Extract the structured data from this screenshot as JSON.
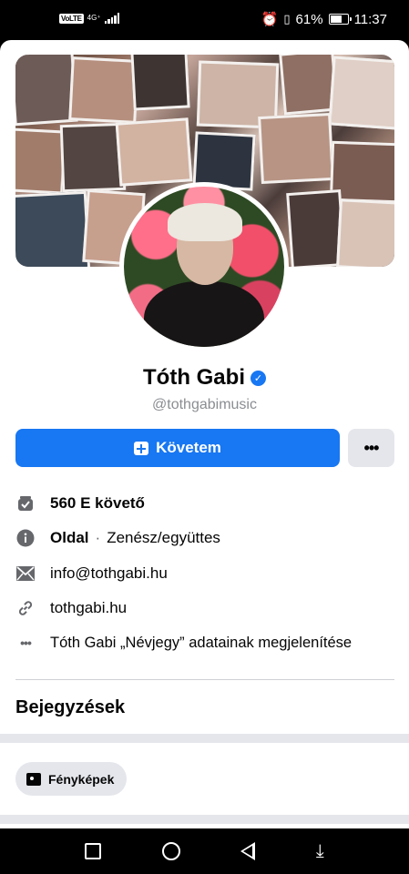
{
  "status_bar": {
    "volte": "VoLTE",
    "network": "4G⁺",
    "battery_percent": "61%",
    "time": "11:37",
    "icons": [
      "alarm-icon",
      "vibrate-icon",
      "battery-icon",
      "signal-icon"
    ]
  },
  "profile": {
    "name": "Tóth Gabi",
    "username": "@tothgabimusic",
    "verified_icon": "verified-badge-icon",
    "cover_icon": "cover-photo",
    "avatar_icon": "profile-photo"
  },
  "actions": {
    "follow_label": "Követem",
    "more_label": "•••"
  },
  "about": {
    "followers": "560 E követő",
    "page_label": "Oldal",
    "page_separator": "·",
    "category": "Zenész/együttes",
    "email": "info@tothgabi.hu",
    "website": "tothgabi.hu",
    "more_info": "Tóth Gabi „Névjegy” adatainak megjelenítése"
  },
  "sections": {
    "posts_title": "Bejegyzések",
    "photos_chip": "Fényképek"
  },
  "colors": {
    "accent": "#1877f2",
    "secondary_button": "#e4e6eb",
    "muted_text": "#65676b"
  }
}
